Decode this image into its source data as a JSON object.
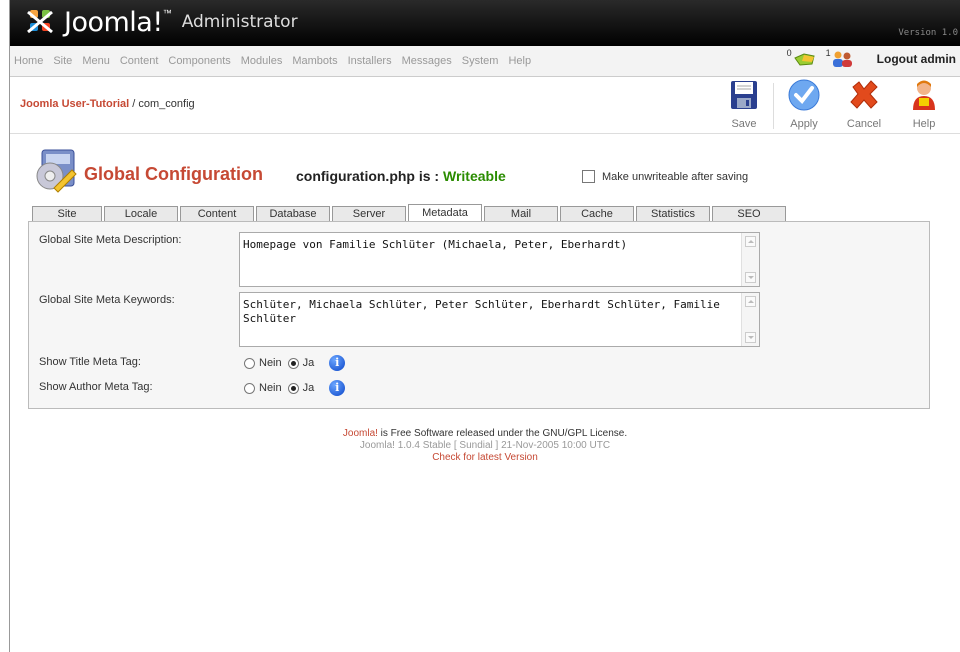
{
  "header": {
    "logo_text": "Joomla!",
    "logo_tm": "™",
    "admin_label": "Administrator",
    "version": "Version 1.0"
  },
  "menu": {
    "items": [
      "Home",
      "Site",
      "Menu",
      "Content",
      "Components",
      "Modules",
      "Mambots",
      "Installers",
      "Messages",
      "System",
      "Help"
    ],
    "messages_count": "0",
    "users_count": "1",
    "logout_label": "Logout admin"
  },
  "toolbar": {
    "breadcrumb_site": "Joomla User-Tutorial",
    "breadcrumb_sep": " / ",
    "breadcrumb_page": "com_config",
    "save_label": "Save",
    "apply_label": "Apply",
    "cancel_label": "Cancel",
    "help_label": "Help"
  },
  "page": {
    "title": "Global Configuration",
    "config_status_prefix": "configuration.php is : ",
    "config_status_value": "Writeable",
    "unwritable_label": "Make unwriteable after saving"
  },
  "tabs": [
    "Site",
    "Locale",
    "Content",
    "Database",
    "Server",
    "Metadata",
    "Mail",
    "Cache",
    "Statistics",
    "SEO"
  ],
  "active_tab": "Metadata",
  "form": {
    "meta_description_label": "Global Site Meta Description:",
    "meta_description_value": "Homepage von Familie Schlüter (Michaela, Peter, Eberhardt)",
    "meta_keywords_label": "Global Site Meta Keywords:",
    "meta_keywords_value": "Schlüter, Michaela Schlüter, Peter Schlüter, Eberhardt Schlüter, Familie Schlüter",
    "show_title_label": "Show Title Meta Tag:",
    "show_author_label": "Show Author Meta Tag:",
    "option_no": "Nein",
    "option_yes": "Ja",
    "show_title_value": "Ja",
    "show_author_value": "Ja",
    "info_glyph": "i"
  },
  "footer": {
    "brand": "Joomla!",
    "license": " is Free Software released under the GNU/GPL License.",
    "version_line": "Joomla! 1.0.4 Stable [ Sundial ] 21-Nov-2005 10:00 UTC",
    "check_link": "Check for latest Version"
  },
  "colors": {
    "accent": "#c64934",
    "writeable": "#2a8c00",
    "info": "#0a45c8"
  }
}
